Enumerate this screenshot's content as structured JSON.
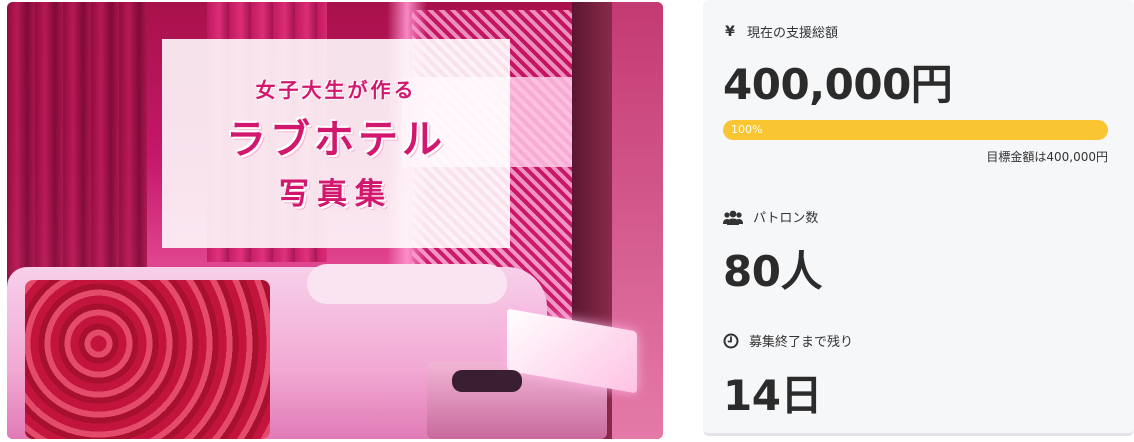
{
  "hero": {
    "line1": "女子大生が作る",
    "line2": "ラブホテル",
    "line3": "写真集"
  },
  "stats": {
    "funding": {
      "icon": "yen-icon",
      "icon_glyph": "¥",
      "label": "現在の支援総額",
      "value": "400,000円",
      "progress_text": "100%",
      "progress_percent": 100,
      "goal_text": "目標金額は400,000円"
    },
    "patrons": {
      "icon": "users-icon",
      "label": "パトロン数",
      "value": "80人"
    },
    "remaining": {
      "icon": "clock-icon",
      "label": "募集終了まで残り",
      "value": "14日"
    }
  },
  "colors": {
    "accent": "#d2176f",
    "progress": "#f9c531",
    "panel_bg": "#f6f7f9"
  }
}
